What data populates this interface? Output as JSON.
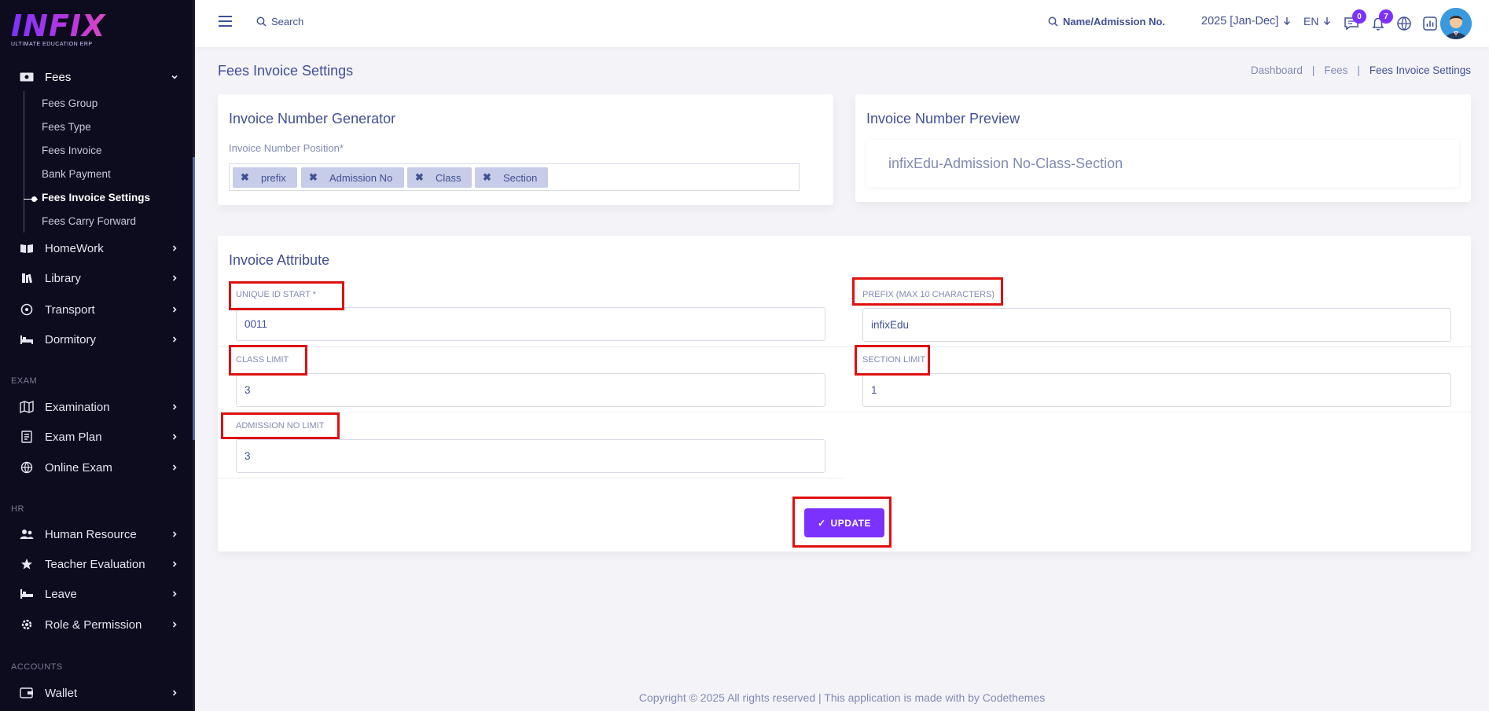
{
  "app": {
    "logo_text": "INFIX",
    "logo_subtitle": "ULTIMATE EDUCATION ERP"
  },
  "sidebar": {
    "fees": {
      "label": "Fees",
      "sub_items": [
        "Fees Group",
        "Fees Type",
        "Fees Invoice",
        "Bank Payment",
        "Fees Invoice Settings",
        "Fees Carry Forward"
      ]
    },
    "items_group1": [
      "HomeWork",
      "Library",
      "Transport",
      "Dormitory"
    ],
    "section_exam": "EXAM",
    "items_exam": [
      "Examination",
      "Exam Plan",
      "Online Exam"
    ],
    "section_hr": "HR",
    "items_hr": [
      "Human Resource",
      "Teacher Evaluation",
      "Leave",
      "Role & Permission"
    ],
    "section_accounts": "ACCOUNTS",
    "items_accounts": [
      "Wallet"
    ]
  },
  "topbar": {
    "search_label": "Search",
    "student_search_label": "Name/Admission No.",
    "academic_year": "2025 [Jan-Dec]",
    "language": "EN",
    "messages_count": "0",
    "notifications_count": "7"
  },
  "page": {
    "title": "Fees Invoice Settings",
    "breadcrumb": [
      "Dashboard",
      "|",
      "Fees",
      "|",
      "Fees Invoice Settings"
    ]
  },
  "generator": {
    "title": "Invoice Number Generator",
    "position_label": "Invoice Number Position*",
    "tags": [
      "prefix",
      "Admission No",
      "Class",
      "Section"
    ],
    "remove_glyph": "✖"
  },
  "preview": {
    "title": "Invoice Number Preview",
    "value": "infixEdu-Admission No-Class-Section"
  },
  "attributes": {
    "title": "Invoice Attribute",
    "unique_id_start": {
      "label": "UNIQUE ID START *",
      "value": "0011"
    },
    "prefix": {
      "label": "PREFIX (MAX 10 CHARACTERS)",
      "value": "infixEdu"
    },
    "class_limit": {
      "label": "CLASS LIMIT",
      "value": "3"
    },
    "section_limit": {
      "label": "SECTION LIMIT",
      "value": "1"
    },
    "admission_no_limit": {
      "label": "ADMISSION NO LIMIT",
      "value": "3"
    }
  },
  "actions": {
    "update_label": "UPDATE",
    "update_check": "✓"
  },
  "footer": {
    "text": "Copyright © 2025 All rights reserved | This application is made with by Codethemes"
  },
  "colors": {
    "accent": "#7c32ff",
    "text_primary": "#415094",
    "text_muted": "#828bb2",
    "sidebar_bg": "#0d0b1e",
    "highlight": "#e01010"
  }
}
